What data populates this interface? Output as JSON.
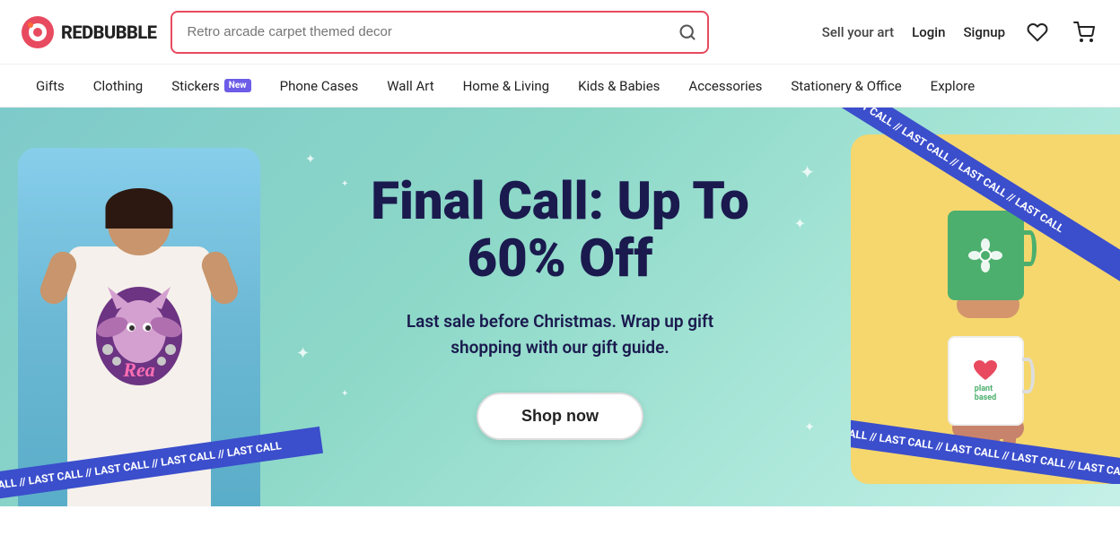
{
  "header": {
    "logo_text": "REDBUBBLE",
    "search_placeholder": "Retro arcade carpet themed decor",
    "sell_label": "Sell your art",
    "login_label": "Login",
    "signup_label": "Signup"
  },
  "nav": {
    "items": [
      {
        "id": "gifts",
        "label": "Gifts",
        "badge": null
      },
      {
        "id": "clothing",
        "label": "Clothing",
        "badge": null
      },
      {
        "id": "stickers",
        "label": "Stickers",
        "badge": "New"
      },
      {
        "id": "phone-cases",
        "label": "Phone Cases",
        "badge": null
      },
      {
        "id": "wall-art",
        "label": "Wall Art",
        "badge": null
      },
      {
        "id": "home-living",
        "label": "Home & Living",
        "badge": null
      },
      {
        "id": "kids-babies",
        "label": "Kids & Babies",
        "badge": null
      },
      {
        "id": "accessories",
        "label": "Accessories",
        "badge": null
      },
      {
        "id": "stationery-office",
        "label": "Stationery & Office",
        "badge": null
      },
      {
        "id": "explore",
        "label": "Explore",
        "badge": null
      }
    ]
  },
  "hero": {
    "title": "Final Call: Up To\n60% Off",
    "subtitle": "Last sale before Christmas. Wrap up gift\nshopping with our gift guide.",
    "cta_label": "Shop now",
    "last_call_text": "LAST CALL // LAST CALL // LAST CALL // LAST CALL // LAST CALL"
  },
  "colors": {
    "accent": "#e84a5f",
    "nav_badge": "#6c5ce7",
    "hero_bg_start": "#7ecaca",
    "hero_bg_end": "#a8e6d8",
    "hero_title": "#1a1a4e",
    "strip_bg": "#3b4ecc"
  }
}
